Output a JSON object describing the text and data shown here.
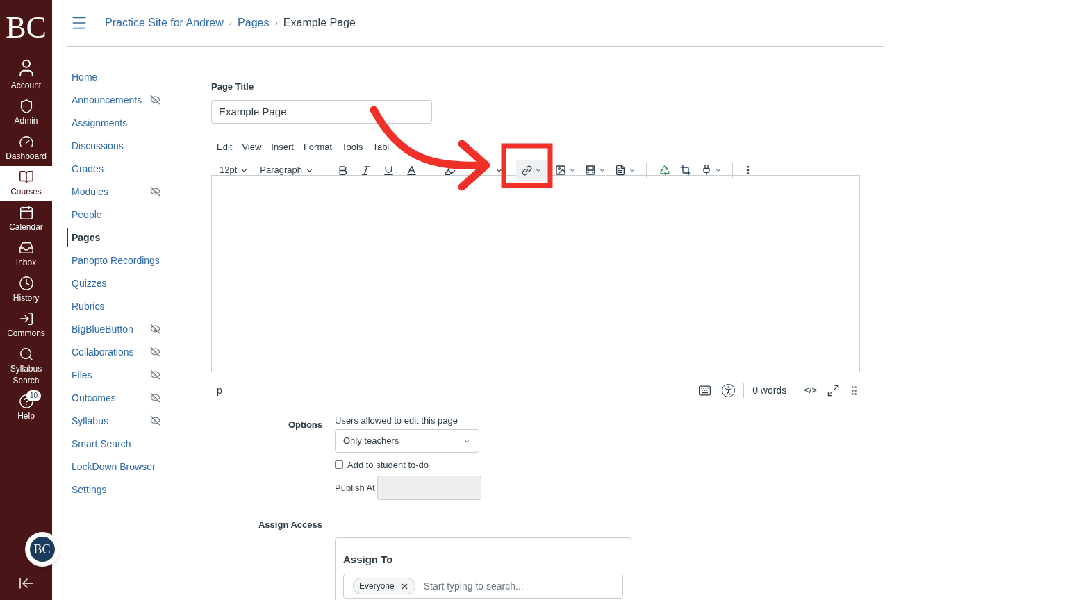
{
  "global_nav": {
    "logo": "BC",
    "items": [
      {
        "label": "Account",
        "selected": false
      },
      {
        "label": "Admin",
        "selected": false
      },
      {
        "label": "Dashboard",
        "selected": false
      },
      {
        "label": "Courses",
        "selected": true
      },
      {
        "label": "Calendar",
        "selected": false
      },
      {
        "label": "Inbox",
        "selected": false
      },
      {
        "label": "History",
        "selected": false
      },
      {
        "label": "Commons",
        "selected": false
      },
      {
        "label": "Syllabus Search",
        "selected": false
      },
      {
        "label": "Help",
        "selected": false,
        "badge": "10"
      }
    ],
    "org_logo": "BC"
  },
  "breadcrumbs": [
    "Practice Site for Andrew",
    "Pages",
    "Example Page"
  ],
  "breadcrumb_separator": "›",
  "course_nav": [
    {
      "label": "Home",
      "selected": false,
      "hidden": false
    },
    {
      "label": "Announcements",
      "selected": false,
      "hidden": true
    },
    {
      "label": "Assignments",
      "selected": false,
      "hidden": false
    },
    {
      "label": "Discussions",
      "selected": false,
      "hidden": false
    },
    {
      "label": "Grades",
      "selected": false,
      "hidden": false
    },
    {
      "label": "Modules",
      "selected": false,
      "hidden": true
    },
    {
      "label": "People",
      "selected": false,
      "hidden": false
    },
    {
      "label": "Pages",
      "selected": true,
      "hidden": false
    },
    {
      "label": "Panopto Recordings",
      "selected": false,
      "hidden": false
    },
    {
      "label": "Quizzes",
      "selected": false,
      "hidden": false
    },
    {
      "label": "Rubrics",
      "selected": false,
      "hidden": false
    },
    {
      "label": "BigBlueButton",
      "selected": false,
      "hidden": true
    },
    {
      "label": "Collaborations",
      "selected": false,
      "hidden": true
    },
    {
      "label": "Files",
      "selected": false,
      "hidden": true
    },
    {
      "label": "Outcomes",
      "selected": false,
      "hidden": true
    },
    {
      "label": "Syllabus",
      "selected": false,
      "hidden": true
    },
    {
      "label": "Smart Search",
      "selected": false,
      "hidden": false
    },
    {
      "label": "LockDown Browser",
      "selected": false,
      "hidden": false
    },
    {
      "label": "Settings",
      "selected": false,
      "hidden": false
    }
  ],
  "page_title": {
    "label": "Page Title",
    "value": "Example Page"
  },
  "editor": {
    "menu": [
      "Edit",
      "View",
      "Insert",
      "Format",
      "Tools",
      "Tabl"
    ],
    "font_size": "12pt",
    "block_format": "Paragraph",
    "path": "p",
    "word_count": "0 words",
    "html_toggle": "</>"
  },
  "options": {
    "label": "Options",
    "edit_label": "Users allowed to edit this page",
    "edit_value": "Only teachers",
    "todo": {
      "label": "Add to student to-do",
      "checked": false
    },
    "publish_at": "Publish At"
  },
  "assign_access": {
    "label": "Assign Access",
    "title": "Assign To",
    "tags": [
      "Everyone"
    ],
    "placeholder": "Start typing to search..."
  }
}
